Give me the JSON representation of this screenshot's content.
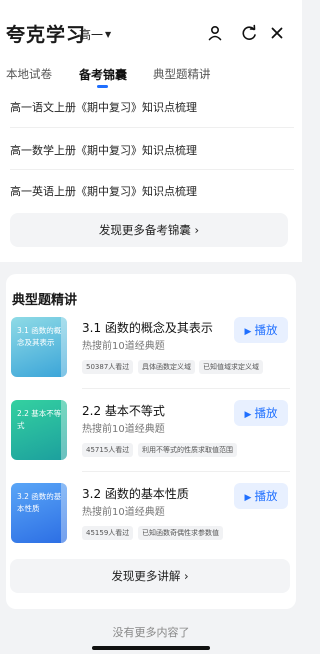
{
  "header": {
    "title": "夸克学习",
    "grade": "高一",
    "icons": [
      "user-icon",
      "refresh-icon",
      "close-icon"
    ]
  },
  "tabs": [
    {
      "label": "本地试卷",
      "active": false
    },
    {
      "label": "备考锦囊",
      "active": true
    },
    {
      "label": "典型题精讲",
      "active": false
    }
  ],
  "documents": [
    "高一语文上册《期中复习》知识点梳理",
    "高一数学上册《期中复习》知识点梳理",
    "高一英语上册《期中复习》知识点梳理"
  ],
  "more_tips": "发现更多备考锦囊 ›",
  "section": {
    "title": "典型题精讲",
    "play_label": "播放",
    "items": [
      {
        "thumb": "3.1 函数的概念及其表示",
        "title": "3.1 函数的概念及其表示",
        "subtitle": "热搜前10道经典题",
        "tags": [
          "50387人看过",
          "具体函数定义域",
          "已知值域求定义域"
        ],
        "color1": "#7dd3e0",
        "color2": "#3aa4d8"
      },
      {
        "thumb": "2.2 基本不等式",
        "title": "2.2 基本不等式",
        "subtitle": "热搜前10道经典题",
        "tags": [
          "45715人看过",
          "利用不等式的性质求取值范围"
        ],
        "color1": "#2ccb9b",
        "color2": "#1ea3a0"
      },
      {
        "thumb": "3.2 函数的基本性质",
        "title": "3.2 函数的基本性质",
        "subtitle": "热搜前10道经典题",
        "tags": [
          "45159人看过",
          "已知函数奇偶性求参数值"
        ],
        "color1": "#4d9cf5",
        "color2": "#2f70e6"
      }
    ],
    "more_label": "发现更多讲解 ›"
  },
  "footer": "没有更多内容了"
}
